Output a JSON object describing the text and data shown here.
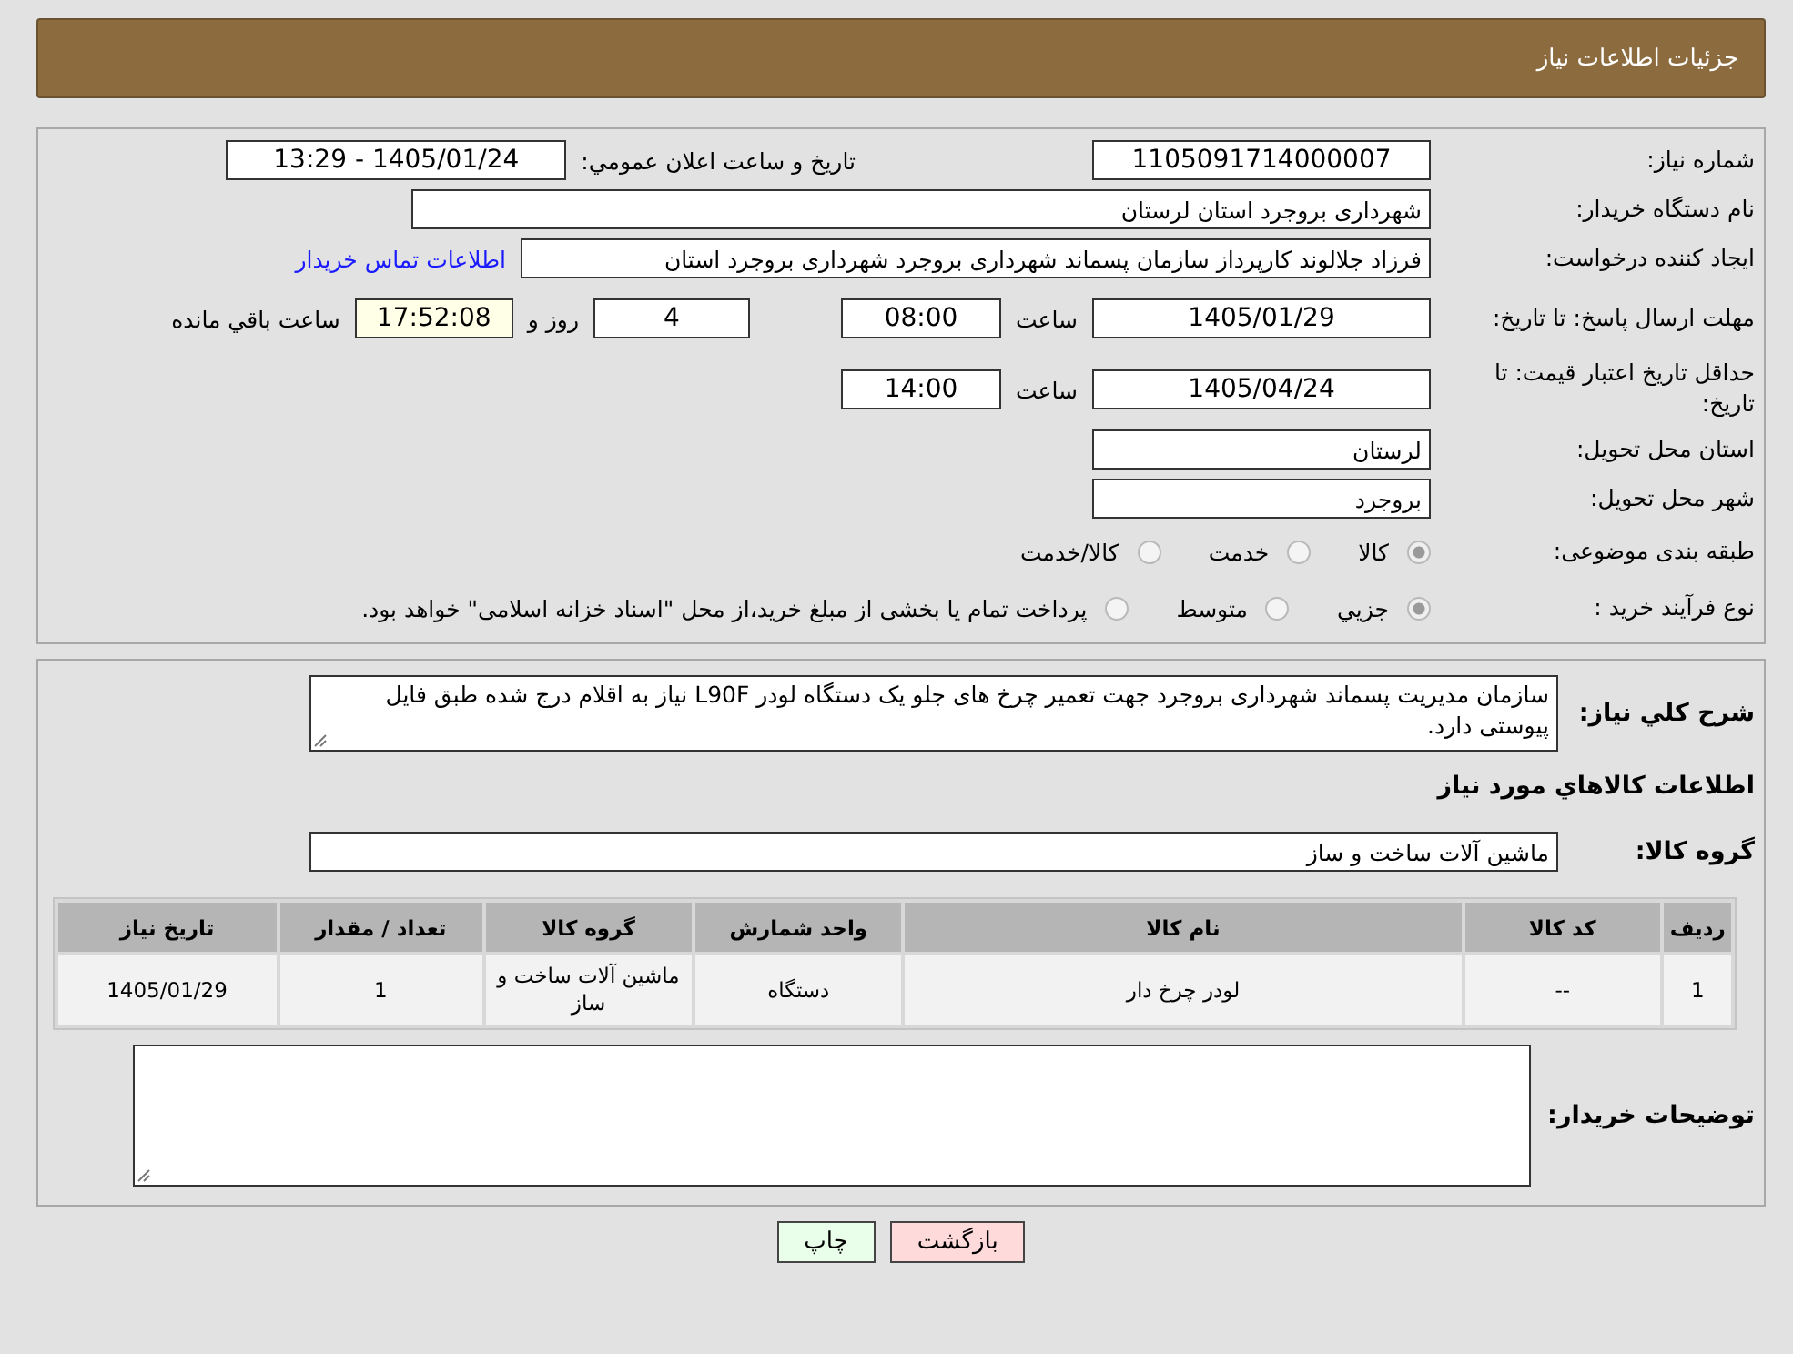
{
  "header": {
    "title": "جزئیات اطلاعات نیاز"
  },
  "details": {
    "need_number": {
      "label": "شماره نیاز:",
      "value": "1105091714000007"
    },
    "announce": {
      "label": "تاریخ و ساعت اعلان عمومي:",
      "value": "1405/01/24 - 13:29"
    },
    "buyer": {
      "label": "نام دستگاه خریدار:",
      "value": "شهرداری بروجرد استان لرستان"
    },
    "creator": {
      "label": "ایجاد کننده درخواست:",
      "value": "فرزاد جلالوند کارپرداز سازمان پسماند شهرداری بروجرد شهرداری بروجرد استان",
      "link": "اطلاعات تماس خریدار"
    },
    "deadline": {
      "label": "مهلت ارسال پاسخ: تا تاریخ:",
      "date": "1405/01/29",
      "time_label": "ساعت",
      "time": "08:00",
      "days": "4",
      "days_label": "روز و",
      "remaining": "17:52:08",
      "remaining_label": "ساعت باقي مانده"
    },
    "validity": {
      "label": "حداقل تاریخ اعتبار قیمت: تا تاریخ:",
      "date": "1405/04/24",
      "time_label": "ساعت",
      "time": "14:00"
    },
    "province": {
      "label": "استان محل تحویل:",
      "value": "لرستان"
    },
    "city": {
      "label": "شهر محل تحویل:",
      "value": "بروجرد"
    },
    "category": {
      "label": "طبقه بندی موضوعی:",
      "options": [
        {
          "label": "کالا",
          "selected": true
        },
        {
          "label": "خدمت",
          "selected": false
        },
        {
          "label": "کالا/خدمت",
          "selected": false
        }
      ]
    },
    "purchase_type": {
      "label": "نوع فرآیند خرید :",
      "options": [
        {
          "label": "جزيي",
          "selected": true
        },
        {
          "label": "متوسط",
          "selected": false
        },
        {
          "label": "پرداخت تمام یا بخشی از مبلغ خرید،از محل \"اسناد خزانه اسلامی\" خواهد بود.",
          "selected": false
        }
      ]
    }
  },
  "description": {
    "label": "شرح کلي نیاز:",
    "value": "سازمان مدیریت پسماند شهرداری بروجرد جهت تعمیر چرخ های جلو یک دستگاه لودر L90F  نیاز به اقلام درج شده طبق فایل پیوستی دارد."
  },
  "goods_title": "اطلاعات کالاهاي مورد نیاز",
  "goods_group": {
    "label": "گروه کالا:",
    "value": "ماشین آلات ساخت و ساز"
  },
  "table": {
    "columns": [
      "ردیف",
      "کد کالا",
      "نام کالا",
      "واحد شمارش",
      "گروه کالا",
      "تعداد / مقدار",
      "تاریخ نیاز"
    ],
    "rows": [
      [
        "1",
        "--",
        "لودر چرخ دار",
        "دستگاه",
        "ماشین آلات ساخت و ساز",
        "1",
        "1405/01/29"
      ]
    ]
  },
  "buyer_notes": {
    "label": "توضیحات خریدار:"
  },
  "buttons": [
    {
      "label": "بازگشت",
      "kind": "back"
    },
    {
      "label": "چاپ",
      "kind": "print"
    }
  ]
}
